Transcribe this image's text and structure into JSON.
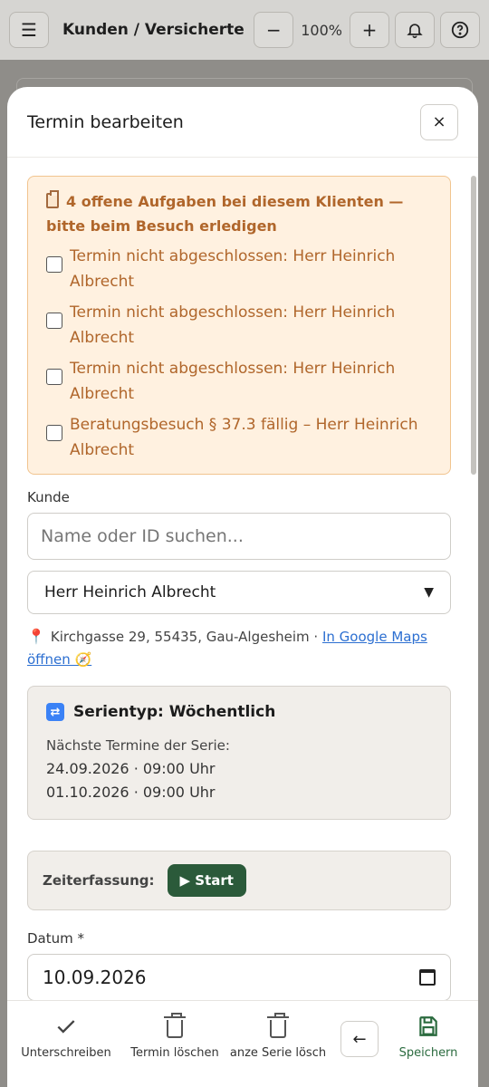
{
  "appbar": {
    "title": "Kunden / Versicherte",
    "zoom_minus": "−",
    "zoom_value": "100%",
    "zoom_plus": "+"
  },
  "modal": {
    "title": "Termin bearbeiten",
    "close": "×"
  },
  "alert": {
    "title": "4 offene Aufgaben bei diesem Klienten — bitte beim Besuch erledigen",
    "tasks": [
      "Termin nicht abgeschlossen: Herr Heinrich Albrecht",
      "Termin nicht abgeschlossen: Herr Heinrich Albrecht",
      "Termin nicht abgeschlossen: Herr Heinrich Albrecht",
      "Beratungsbesuch § 37.3 fällig – Herr Heinrich Albrecht"
    ]
  },
  "customer": {
    "label": "Kunde",
    "search_placeholder": "Name oder ID suchen...",
    "selected": "Herr Heinrich Albrecht",
    "address": "Kirchgasse 29, 55435, Gau-Algesheim ·",
    "maps_link": "In Google Maps öffnen 🧭"
  },
  "series": {
    "title": "Serientyp: Wöchentlich",
    "subtitle": "Nächste Termine der Serie:",
    "dates": [
      "24.09.2026 · 09:00 Uhr",
      "01.10.2026 · 09:00 Uhr"
    ]
  },
  "time_tracking": {
    "label": "Zeiterfassung:",
    "start": "▶ Start"
  },
  "date": {
    "label": "Datum *",
    "value": "10.09.2026"
  },
  "actions": {
    "sign": "Unterschreiben",
    "delete_appt": "Termin löschen",
    "delete_series": "anze Serie lösch",
    "save": "Speichern"
  },
  "colors": {
    "accent_green": "#2b5a3a",
    "alert_text": "#b0662b",
    "alert_bg": "#fff1e0",
    "link": "#2c6fd1"
  }
}
